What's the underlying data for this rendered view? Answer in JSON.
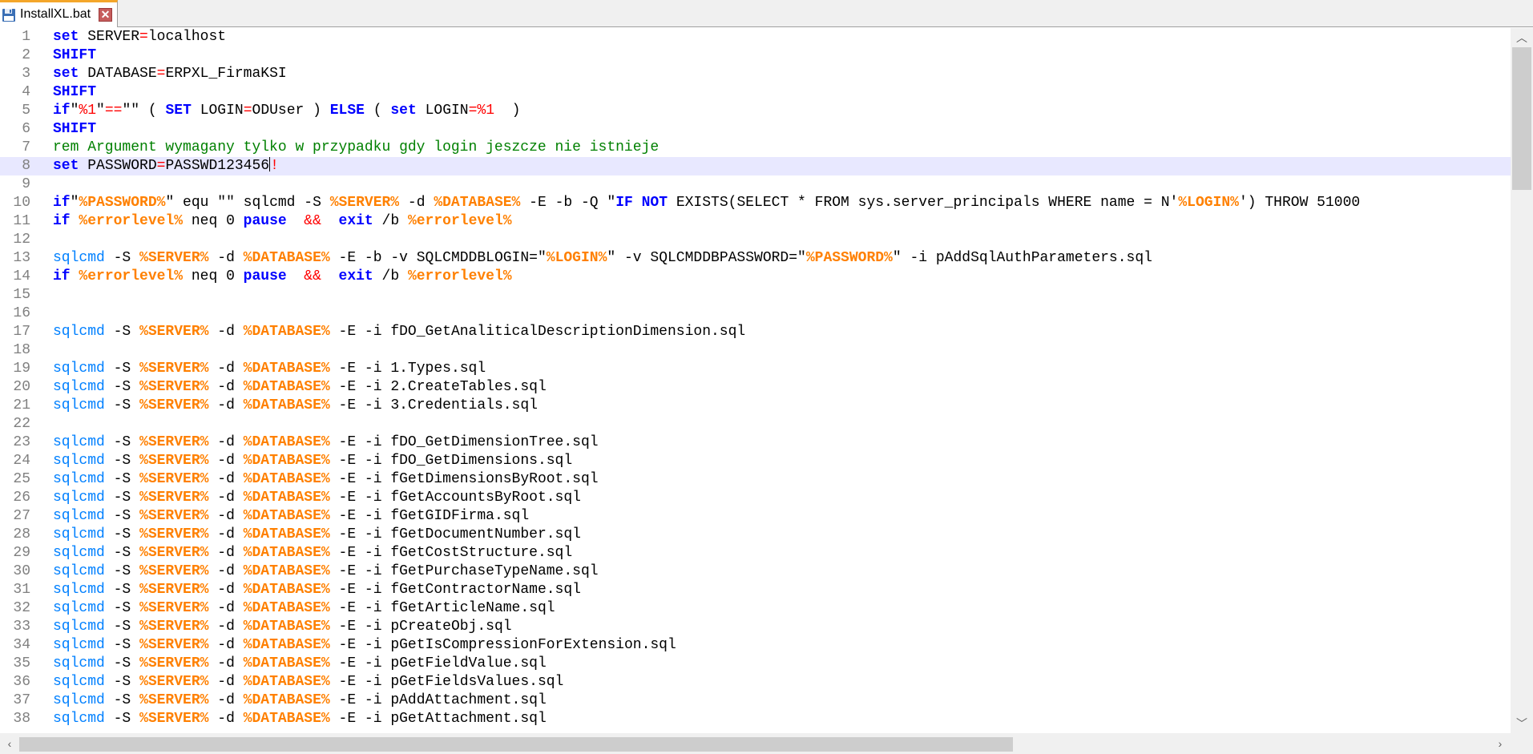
{
  "tab": {
    "label": "InstallXL.bat",
    "save_icon": "floppy-disk-icon",
    "close_icon": "close-icon",
    "close_glyph": "✕"
  },
  "colors": {
    "keyword": "#0000ff",
    "command": "#0080ff",
    "variable": "#ff8000",
    "operator": "#ff0000",
    "comment": "#008000",
    "current_line": "#e8e8ff",
    "tab_accent": "#f4a62a"
  },
  "scrollbar": {
    "up": "︿",
    "down": "﹀",
    "left": "‹",
    "right": "›"
  },
  "current_line": 8,
  "editor": {
    "lines": [
      [
        [
          "kw",
          "set"
        ],
        [
          "",
          "SERVER"
        ],
        [
          "op",
          "="
        ],
        [
          "",
          "localhost"
        ]
      ],
      [
        [
          "kw",
          "SHIFT"
        ]
      ],
      [
        [
          "kw",
          "set"
        ],
        [
          "",
          "DATABASE"
        ],
        [
          "op",
          "="
        ],
        [
          "",
          "ERPXL_FirmaKSI"
        ]
      ],
      [
        [
          "kw",
          "SHIFT"
        ]
      ],
      [
        [
          "kw",
          "if"
        ],
        [
          "",
          "\""
        ],
        [
          "op",
          "%1"
        ],
        [
          "",
          "\""
        ],
        [
          "op",
          "=="
        ],
        [
          "",
          "\"\" ( "
        ],
        [
          "kw",
          "SET"
        ],
        [
          "",
          "LOGIN"
        ],
        [
          "op",
          "="
        ],
        [
          "",
          "ODUser ) "
        ],
        [
          "kw",
          "ELSE"
        ],
        [
          "",
          ""
        ],
        [
          "",
          "( "
        ],
        [
          "kw",
          "set"
        ],
        [
          "",
          "LOGIN"
        ],
        [
          "op",
          "=%1"
        ],
        [
          "",
          "  )"
        ]
      ],
      [
        [
          "kw",
          "SHIFT"
        ]
      ],
      [
        [
          "cm",
          "rem Argument wymagany tylko w przypadku gdy login jeszcze nie istnieje"
        ]
      ],
      [
        [
          "kw",
          "set"
        ],
        [
          "",
          "PASSWORD"
        ],
        [
          "op",
          "="
        ],
        [
          "",
          "PASSWD123456"
        ],
        [
          "cursor",
          ""
        ],
        [
          "op",
          "!"
        ]
      ],
      [],
      [
        [
          "kw",
          "if"
        ],
        [
          "",
          "\""
        ],
        [
          "var",
          "%PASSWORD%"
        ],
        [
          "",
          "\" equ \"\" sqlcmd -S "
        ],
        [
          "var",
          "%SERVER%"
        ],
        [
          "",
          "-d "
        ],
        [
          "var",
          "%DATABASE%"
        ],
        [
          "",
          "-E -b -Q \""
        ],
        [
          "kw",
          "IF NOT"
        ],
        [
          "",
          "EXISTS(SELECT * FROM sys.server_principals WHERE name = N'"
        ],
        [
          "var",
          "%LOGIN%"
        ],
        [
          "",
          "') THROW 51000"
        ]
      ],
      [
        [
          "kw",
          "if"
        ],
        [
          "var",
          "%errorlevel%"
        ],
        [
          "",
          "neq 0 "
        ],
        [
          "kw",
          "pause"
        ],
        [
          "",
          "  "
        ],
        [
          "op",
          "&&"
        ],
        [
          "",
          "  "
        ],
        [
          "kw",
          "exit"
        ],
        [
          "",
          "/b "
        ],
        [
          "var",
          "%errorlevel%"
        ]
      ],
      [],
      [
        [
          "cmd",
          "sqlcmd"
        ],
        [
          "",
          "-S "
        ],
        [
          "var",
          "%SERVER%"
        ],
        [
          "",
          "-d "
        ],
        [
          "var",
          "%DATABASE%"
        ],
        [
          "",
          "-E -b -v SQLCMDDBLOGIN=\""
        ],
        [
          "var",
          "%LOGIN%"
        ],
        [
          "",
          "\" -v SQLCMDDBPASSWORD=\""
        ],
        [
          "var",
          "%PASSWORD%"
        ],
        [
          "",
          "\" -i pAddSqlAuthParameters.sql"
        ]
      ],
      [
        [
          "kw",
          "if"
        ],
        [
          "var",
          "%errorlevel%"
        ],
        [
          "",
          "neq 0 "
        ],
        [
          "kw",
          "pause"
        ],
        [
          "",
          "  "
        ],
        [
          "op",
          "&&"
        ],
        [
          "",
          "  "
        ],
        [
          "kw",
          "exit"
        ],
        [
          "",
          "/b "
        ],
        [
          "var",
          "%errorlevel%"
        ]
      ],
      [],
      [],
      [
        [
          "cmd",
          "sqlcmd"
        ],
        [
          "",
          "-S "
        ],
        [
          "var",
          "%SERVER%"
        ],
        [
          "",
          "-d "
        ],
        [
          "var",
          "%DATABASE%"
        ],
        [
          "",
          "-E -i fDO_GetAnaliticalDescriptionDimension.sql"
        ]
      ],
      [],
      [
        [
          "cmd",
          "sqlcmd"
        ],
        [
          "",
          "-S "
        ],
        [
          "var",
          "%SERVER%"
        ],
        [
          "",
          "-d "
        ],
        [
          "var",
          "%DATABASE%"
        ],
        [
          "",
          "-E -i 1.Types.sql"
        ]
      ],
      [
        [
          "cmd",
          "sqlcmd"
        ],
        [
          "",
          "-S "
        ],
        [
          "var",
          "%SERVER%"
        ],
        [
          "",
          "-d "
        ],
        [
          "var",
          "%DATABASE%"
        ],
        [
          "",
          "-E -i 2.CreateTables.sql"
        ]
      ],
      [
        [
          "cmd",
          "sqlcmd"
        ],
        [
          "",
          "-S "
        ],
        [
          "var",
          "%SERVER%"
        ],
        [
          "",
          "-d "
        ],
        [
          "var",
          "%DATABASE%"
        ],
        [
          "",
          "-E -i 3.Credentials.sql"
        ]
      ],
      [],
      [
        [
          "cmd",
          "sqlcmd"
        ],
        [
          "",
          "-S "
        ],
        [
          "var",
          "%SERVER%"
        ],
        [
          "",
          "-d "
        ],
        [
          "var",
          "%DATABASE%"
        ],
        [
          "",
          "-E -i fDO_GetDimensionTree.sql"
        ]
      ],
      [
        [
          "cmd",
          "sqlcmd"
        ],
        [
          "",
          "-S "
        ],
        [
          "var",
          "%SERVER%"
        ],
        [
          "",
          "-d "
        ],
        [
          "var",
          "%DATABASE%"
        ],
        [
          "",
          "-E -i fDO_GetDimensions.sql"
        ]
      ],
      [
        [
          "cmd",
          "sqlcmd"
        ],
        [
          "",
          "-S "
        ],
        [
          "var",
          "%SERVER%"
        ],
        [
          "",
          "-d "
        ],
        [
          "var",
          "%DATABASE%"
        ],
        [
          "",
          "-E -i fGetDimensionsByRoot.sql"
        ]
      ],
      [
        [
          "cmd",
          "sqlcmd"
        ],
        [
          "",
          "-S "
        ],
        [
          "var",
          "%SERVER%"
        ],
        [
          "",
          "-d "
        ],
        [
          "var",
          "%DATABASE%"
        ],
        [
          "",
          "-E -i fGetAccountsByRoot.sql"
        ]
      ],
      [
        [
          "cmd",
          "sqlcmd"
        ],
        [
          "",
          "-S "
        ],
        [
          "var",
          "%SERVER%"
        ],
        [
          "",
          "-d "
        ],
        [
          "var",
          "%DATABASE%"
        ],
        [
          "",
          "-E -i fGetGIDFirma.sql"
        ]
      ],
      [
        [
          "cmd",
          "sqlcmd"
        ],
        [
          "",
          "-S "
        ],
        [
          "var",
          "%SERVER%"
        ],
        [
          "",
          "-d "
        ],
        [
          "var",
          "%DATABASE%"
        ],
        [
          "",
          "-E -i fGetDocumentNumber.sql"
        ]
      ],
      [
        [
          "cmd",
          "sqlcmd"
        ],
        [
          "",
          "-S "
        ],
        [
          "var",
          "%SERVER%"
        ],
        [
          "",
          "-d "
        ],
        [
          "var",
          "%DATABASE%"
        ],
        [
          "",
          "-E -i fGetCostStructure.sql"
        ]
      ],
      [
        [
          "cmd",
          "sqlcmd"
        ],
        [
          "",
          "-S "
        ],
        [
          "var",
          "%SERVER%"
        ],
        [
          "",
          "-d "
        ],
        [
          "var",
          "%DATABASE%"
        ],
        [
          "",
          "-E -i fGetPurchaseTypeName.sql"
        ]
      ],
      [
        [
          "cmd",
          "sqlcmd"
        ],
        [
          "",
          "-S "
        ],
        [
          "var",
          "%SERVER%"
        ],
        [
          "",
          "-d "
        ],
        [
          "var",
          "%DATABASE%"
        ],
        [
          "",
          "-E -i fGetContractorName.sql"
        ]
      ],
      [
        [
          "cmd",
          "sqlcmd"
        ],
        [
          "",
          "-S "
        ],
        [
          "var",
          "%SERVER%"
        ],
        [
          "",
          "-d "
        ],
        [
          "var",
          "%DATABASE%"
        ],
        [
          "",
          "-E -i fGetArticleName.sql"
        ]
      ],
      [
        [
          "cmd",
          "sqlcmd"
        ],
        [
          "",
          "-S "
        ],
        [
          "var",
          "%SERVER%"
        ],
        [
          "",
          "-d "
        ],
        [
          "var",
          "%DATABASE%"
        ],
        [
          "",
          "-E -i pCreateObj.sql"
        ]
      ],
      [
        [
          "cmd",
          "sqlcmd"
        ],
        [
          "",
          "-S "
        ],
        [
          "var",
          "%SERVER%"
        ],
        [
          "",
          "-d "
        ],
        [
          "var",
          "%DATABASE%"
        ],
        [
          "",
          "-E -i pGetIsCompressionForExtension.sql"
        ]
      ],
      [
        [
          "cmd",
          "sqlcmd"
        ],
        [
          "",
          "-S "
        ],
        [
          "var",
          "%SERVER%"
        ],
        [
          "",
          "-d "
        ],
        [
          "var",
          "%DATABASE%"
        ],
        [
          "",
          "-E -i pGetFieldValue.sql"
        ]
      ],
      [
        [
          "cmd",
          "sqlcmd"
        ],
        [
          "",
          "-S "
        ],
        [
          "var",
          "%SERVER%"
        ],
        [
          "",
          "-d "
        ],
        [
          "var",
          "%DATABASE%"
        ],
        [
          "",
          "-E -i pGetFieldsValues.sql"
        ]
      ],
      [
        [
          "cmd",
          "sqlcmd"
        ],
        [
          "",
          "-S "
        ],
        [
          "var",
          "%SERVER%"
        ],
        [
          "",
          "-d "
        ],
        [
          "var",
          "%DATABASE%"
        ],
        [
          "",
          "-E -i pAddAttachment.sql"
        ]
      ],
      [
        [
          "cmd",
          "sqlcmd"
        ],
        [
          "",
          "-S "
        ],
        [
          "var",
          "%SERVER%"
        ],
        [
          "",
          "-d "
        ],
        [
          "var",
          "%DATABASE%"
        ],
        [
          "",
          "-E -i pGetAttachment.sql"
        ]
      ]
    ]
  }
}
